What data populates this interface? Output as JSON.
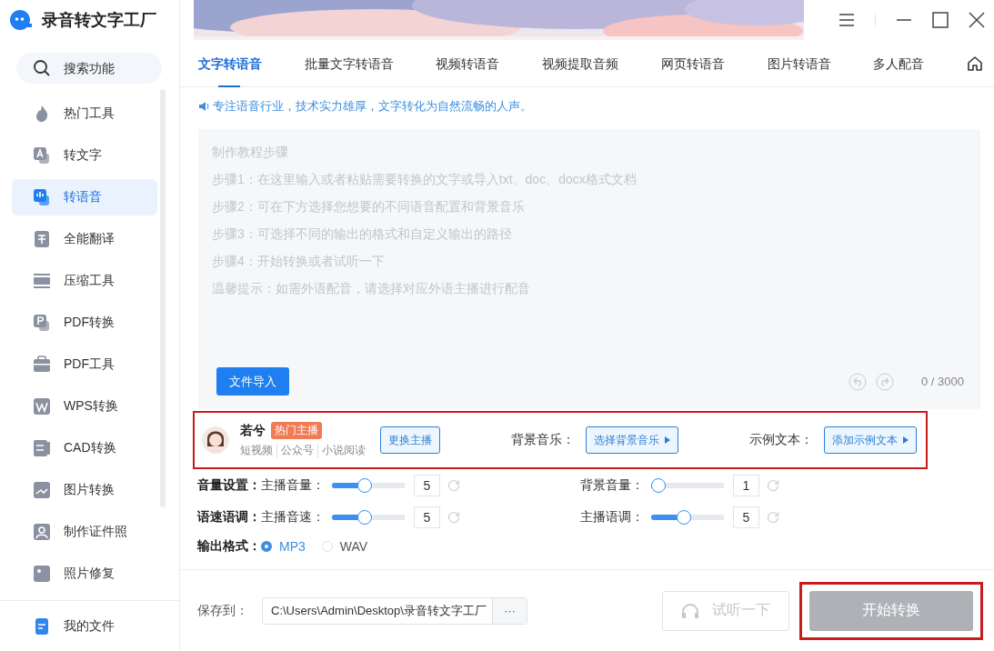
{
  "app": {
    "title": "录音转文字工厂"
  },
  "sidebar": {
    "search": {
      "placeholder": "搜索功能"
    },
    "items": [
      {
        "label": "热门工具",
        "selected": false
      },
      {
        "label": "转文字",
        "selected": false
      },
      {
        "label": "转语音",
        "selected": true
      },
      {
        "label": "全能翻译",
        "selected": false
      },
      {
        "label": "压缩工具",
        "selected": false
      },
      {
        "label": "PDF转换",
        "selected": false
      },
      {
        "label": "PDF工具",
        "selected": false
      },
      {
        "label": "WPS转换",
        "selected": false
      },
      {
        "label": "CAD转换",
        "selected": false
      },
      {
        "label": "图片转换",
        "selected": false
      },
      {
        "label": "制作证件照",
        "selected": false
      },
      {
        "label": "照片修复",
        "selected": false
      }
    ],
    "footer": {
      "label": "我的文件"
    }
  },
  "tabs": [
    {
      "label": "文字转语音",
      "selected": true
    },
    {
      "label": "批量文字转语音",
      "selected": false
    },
    {
      "label": "视频转语音",
      "selected": false
    },
    {
      "label": "视频提取音频",
      "selected": false
    },
    {
      "label": "网页转语音",
      "selected": false
    },
    {
      "label": "图片转语音",
      "selected": false
    },
    {
      "label": "多人配音",
      "selected": false
    }
  ],
  "notice": "专注语音行业，技术实力雄厚，文字转化为自然流畅的人声。",
  "editor": {
    "placeholder_lines": [
      "制作教程步骤",
      "步骤1：在这里输入或者粘贴需要转换的文字或导入txt、doc、docx格式文档",
      "步骤2：可在下方选择您想要的不同语音配置和背景音乐",
      "步骤3：可选择不同的输出的格式和自定义输出的路径",
      "步骤4：开始转换或者试听一下",
      "温馨提示：如需外语配音，请选择对应外语主播进行配音"
    ],
    "import_button": "文件导入",
    "counter": "0 / 3000"
  },
  "voice_bar": {
    "highlighted": true,
    "name": "若兮",
    "badge": "热门主播",
    "tags": [
      "短视频",
      "公众号",
      "小说阅读"
    ],
    "change_button": "更换主播",
    "music_label": "背景音乐：",
    "music_button": "选择背景音乐",
    "sample_label": "示例文本：",
    "sample_button": "添加示例文本"
  },
  "settings": [
    {
      "label": "音量设置：",
      "controls": [
        {
          "label": "主播音量：",
          "level": 0.44,
          "value": "5"
        },
        {
          "label": "背景音量：",
          "level": 0,
          "value": "1"
        }
      ]
    },
    {
      "label": "语速语调：",
      "controls": [
        {
          "label": "主播音速：",
          "level": 0.44,
          "value": "5"
        },
        {
          "label": "主播语调：",
          "level": 0.44,
          "value": "5"
        }
      ]
    }
  ],
  "output_format": {
    "label": "输出格式：",
    "options": [
      {
        "label": "MP3",
        "selected": true
      },
      {
        "label": "WAV",
        "selected": false
      }
    ]
  },
  "footer": {
    "save_label": "保存到：",
    "path": "C:\\Users\\Admin\\Desktop\\录音转文字工厂",
    "browse_button": "···",
    "preview_button": {
      "label": "试听一下",
      "disabled": true
    },
    "start_button": {
      "label": "开始转换",
      "disabled": true,
      "highlighted": true
    }
  }
}
